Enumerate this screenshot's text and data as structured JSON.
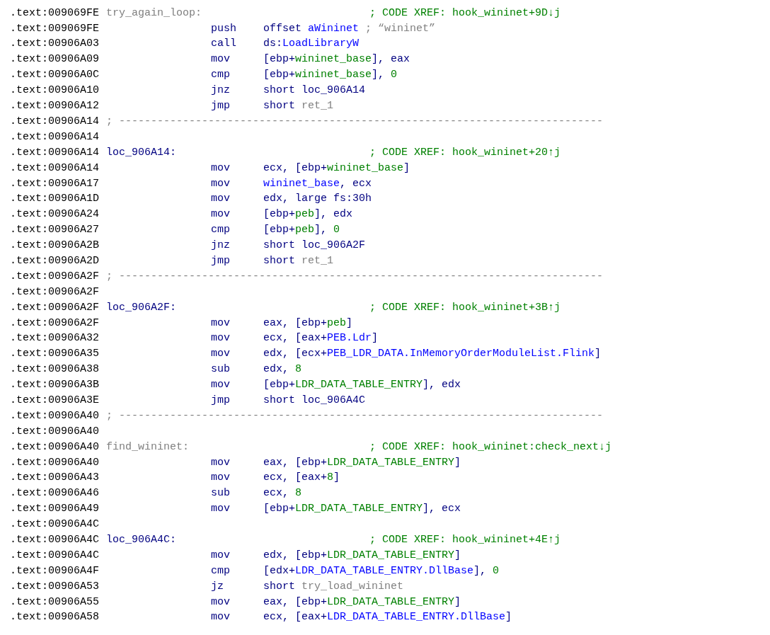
{
  "listing": [
    {
      "kind": "label",
      "address": ".text:009069FE",
      "label": {
        "t": "try_again_loop:",
        "kind": "dim"
      },
      "comment": "; CODE XREF: hook_wininet+9D↓j"
    },
    {
      "kind": "instr",
      "address": ".text:009069FE",
      "mnemonic": "push",
      "operand": [
        {
          "t": "offset ",
          "kind": "reg"
        },
        {
          "t": "aWininet",
          "kind": "sym"
        },
        {
          "t": " ; “wininet”",
          "kind": "dim"
        }
      ]
    },
    {
      "kind": "instr",
      "address": ".text:00906A03",
      "mnemonic": "call",
      "operand": [
        {
          "t": "ds:",
          "kind": "reg"
        },
        {
          "t": "LoadLibraryW",
          "kind": "sym"
        }
      ]
    },
    {
      "kind": "instr",
      "address": ".text:00906A09",
      "mnemonic": "mov",
      "operand": [
        {
          "t": "[ebp+",
          "kind": "reg"
        },
        {
          "t": "wininet_base",
          "kind": "var"
        },
        {
          "t": "], eax",
          "kind": "reg"
        }
      ]
    },
    {
      "kind": "instr",
      "address": ".text:00906A0C",
      "mnemonic": "cmp",
      "operand": [
        {
          "t": "[ebp+",
          "kind": "reg"
        },
        {
          "t": "wininet_base",
          "kind": "var"
        },
        {
          "t": "], ",
          "kind": "reg"
        },
        {
          "t": "0",
          "kind": "var"
        }
      ]
    },
    {
      "kind": "instr",
      "address": ".text:00906A10",
      "mnemonic": "jnz",
      "operand": [
        {
          "t": "short loc_906A14",
          "kind": "reg"
        }
      ]
    },
    {
      "kind": "instr",
      "address": ".text:00906A12",
      "mnemonic": "jmp",
      "operand": [
        {
          "t": "short ",
          "kind": "reg"
        },
        {
          "t": "ret_1",
          "kind": "dim"
        }
      ]
    },
    {
      "kind": "separator",
      "address": ".text:00906A14",
      "text": "; ----------------------------------------------------------------------------"
    },
    {
      "kind": "blank",
      "address": ".text:00906A14"
    },
    {
      "kind": "label",
      "address": ".text:00906A14",
      "label": {
        "t": "loc_906A14:",
        "kind": "reg"
      },
      "comment": "; CODE XREF: hook_wininet+20↑j"
    },
    {
      "kind": "instr",
      "address": ".text:00906A14",
      "mnemonic": "mov",
      "operand": [
        {
          "t": "ecx, [ebp+",
          "kind": "reg"
        },
        {
          "t": "wininet_base",
          "kind": "var"
        },
        {
          "t": "]",
          "kind": "reg"
        }
      ]
    },
    {
      "kind": "instr",
      "address": ".text:00906A17",
      "mnemonic": "mov",
      "operand": [
        {
          "t": "wininet_base",
          "kind": "sym"
        },
        {
          "t": ", ecx",
          "kind": "reg"
        }
      ]
    },
    {
      "kind": "instr",
      "address": ".text:00906A1D",
      "mnemonic": "mov",
      "operand": [
        {
          "t": "edx, large fs:30h",
          "kind": "reg"
        }
      ]
    },
    {
      "kind": "instr",
      "address": ".text:00906A24",
      "mnemonic": "mov",
      "operand": [
        {
          "t": "[ebp+",
          "kind": "reg"
        },
        {
          "t": "peb",
          "kind": "var"
        },
        {
          "t": "], edx",
          "kind": "reg"
        }
      ]
    },
    {
      "kind": "instr",
      "address": ".text:00906A27",
      "mnemonic": "cmp",
      "operand": [
        {
          "t": "[ebp+",
          "kind": "reg"
        },
        {
          "t": "peb",
          "kind": "var"
        },
        {
          "t": "], ",
          "kind": "reg"
        },
        {
          "t": "0",
          "kind": "var"
        }
      ]
    },
    {
      "kind": "instr",
      "address": ".text:00906A2B",
      "mnemonic": "jnz",
      "operand": [
        {
          "t": "short loc_906A2F",
          "kind": "reg"
        }
      ]
    },
    {
      "kind": "instr",
      "address": ".text:00906A2D",
      "mnemonic": "jmp",
      "operand": [
        {
          "t": "short ",
          "kind": "reg"
        },
        {
          "t": "ret_1",
          "kind": "dim"
        }
      ]
    },
    {
      "kind": "separator",
      "address": ".text:00906A2F",
      "text": "; ----------------------------------------------------------------------------"
    },
    {
      "kind": "blank",
      "address": ".text:00906A2F"
    },
    {
      "kind": "label",
      "address": ".text:00906A2F",
      "label": {
        "t": "loc_906A2F:",
        "kind": "reg"
      },
      "comment": "; CODE XREF: hook_wininet+3B↑j"
    },
    {
      "kind": "instr",
      "address": ".text:00906A2F",
      "mnemonic": "mov",
      "operand": [
        {
          "t": "eax, [ebp+",
          "kind": "reg"
        },
        {
          "t": "peb",
          "kind": "var"
        },
        {
          "t": "]",
          "kind": "reg"
        }
      ]
    },
    {
      "kind": "instr",
      "address": ".text:00906A32",
      "mnemonic": "mov",
      "operand": [
        {
          "t": "ecx, [eax+",
          "kind": "reg"
        },
        {
          "t": "PEB.Ldr",
          "kind": "sym"
        },
        {
          "t": "]",
          "kind": "reg"
        }
      ]
    },
    {
      "kind": "instr",
      "address": ".text:00906A35",
      "mnemonic": "mov",
      "operand": [
        {
          "t": "edx, [ecx+",
          "kind": "reg"
        },
        {
          "t": "PEB_LDR_DATA.InMemoryOrderModuleList.Flink",
          "kind": "sym"
        },
        {
          "t": "]",
          "kind": "reg"
        }
      ]
    },
    {
      "kind": "instr",
      "address": ".text:00906A38",
      "mnemonic": "sub",
      "operand": [
        {
          "t": "edx, ",
          "kind": "reg"
        },
        {
          "t": "8",
          "kind": "var"
        }
      ]
    },
    {
      "kind": "instr",
      "address": ".text:00906A3B",
      "mnemonic": "mov",
      "operand": [
        {
          "t": "[ebp+",
          "kind": "reg"
        },
        {
          "t": "LDR_DATA_TABLE_ENTRY",
          "kind": "var"
        },
        {
          "t": "], edx",
          "kind": "reg"
        }
      ]
    },
    {
      "kind": "instr",
      "address": ".text:00906A3E",
      "mnemonic": "jmp",
      "operand": [
        {
          "t": "short loc_906A4C",
          "kind": "reg"
        }
      ]
    },
    {
      "kind": "separator",
      "address": ".text:00906A40",
      "text": "; ----------------------------------------------------------------------------"
    },
    {
      "kind": "blank",
      "address": ".text:00906A40"
    },
    {
      "kind": "label",
      "address": ".text:00906A40",
      "label": {
        "t": "find_wininet:",
        "kind": "dim"
      },
      "comment": "; CODE XREF: hook_wininet:check_next↓j"
    },
    {
      "kind": "instr",
      "address": ".text:00906A40",
      "mnemonic": "mov",
      "operand": [
        {
          "t": "eax, [ebp+",
          "kind": "reg"
        },
        {
          "t": "LDR_DATA_TABLE_ENTRY",
          "kind": "var"
        },
        {
          "t": "]",
          "kind": "reg"
        }
      ]
    },
    {
      "kind": "instr",
      "address": ".text:00906A43",
      "mnemonic": "mov",
      "operand": [
        {
          "t": "ecx, [eax+",
          "kind": "reg"
        },
        {
          "t": "8",
          "kind": "var"
        },
        {
          "t": "]",
          "kind": "reg"
        }
      ]
    },
    {
      "kind": "instr",
      "address": ".text:00906A46",
      "mnemonic": "sub",
      "operand": [
        {
          "t": "ecx, ",
          "kind": "reg"
        },
        {
          "t": "8",
          "kind": "var"
        }
      ]
    },
    {
      "kind": "instr",
      "address": ".text:00906A49",
      "mnemonic": "mov",
      "operand": [
        {
          "t": "[ebp+",
          "kind": "reg"
        },
        {
          "t": "LDR_DATA_TABLE_ENTRY",
          "kind": "var"
        },
        {
          "t": "], ecx",
          "kind": "reg"
        }
      ]
    },
    {
      "kind": "blank",
      "address": ".text:00906A4C"
    },
    {
      "kind": "label",
      "address": ".text:00906A4C",
      "label": {
        "t": "loc_906A4C:",
        "kind": "reg"
      },
      "comment": "; CODE XREF: hook_wininet+4E↑j"
    },
    {
      "kind": "instr",
      "address": ".text:00906A4C",
      "mnemonic": "mov",
      "operand": [
        {
          "t": "edx, [ebp+",
          "kind": "reg"
        },
        {
          "t": "LDR_DATA_TABLE_ENTRY",
          "kind": "var"
        },
        {
          "t": "]",
          "kind": "reg"
        }
      ]
    },
    {
      "kind": "instr",
      "address": ".text:00906A4F",
      "mnemonic": "cmp",
      "operand": [
        {
          "t": "[edx+",
          "kind": "reg"
        },
        {
          "t": "LDR_DATA_TABLE_ENTRY.DllBase",
          "kind": "sym"
        },
        {
          "t": "], ",
          "kind": "reg"
        },
        {
          "t": "0",
          "kind": "var"
        }
      ]
    },
    {
      "kind": "instr",
      "address": ".text:00906A53",
      "mnemonic": "jz",
      "operand": [
        {
          "t": "short ",
          "kind": "reg"
        },
        {
          "t": "try_load_wininet",
          "kind": "dim"
        }
      ]
    },
    {
      "kind": "instr",
      "address": ".text:00906A55",
      "mnemonic": "mov",
      "operand": [
        {
          "t": "eax, [ebp+",
          "kind": "reg"
        },
        {
          "t": "LDR_DATA_TABLE_ENTRY",
          "kind": "var"
        },
        {
          "t": "]",
          "kind": "reg"
        }
      ]
    },
    {
      "kind": "instr",
      "address": ".text:00906A58",
      "mnemonic": "mov",
      "operand": [
        {
          "t": "ecx, [eax+",
          "kind": "reg"
        },
        {
          "t": "LDR_DATA_TABLE_ENTRY.DllBase",
          "kind": "sym"
        },
        {
          "t": "]",
          "kind": "reg"
        }
      ]
    }
  ]
}
